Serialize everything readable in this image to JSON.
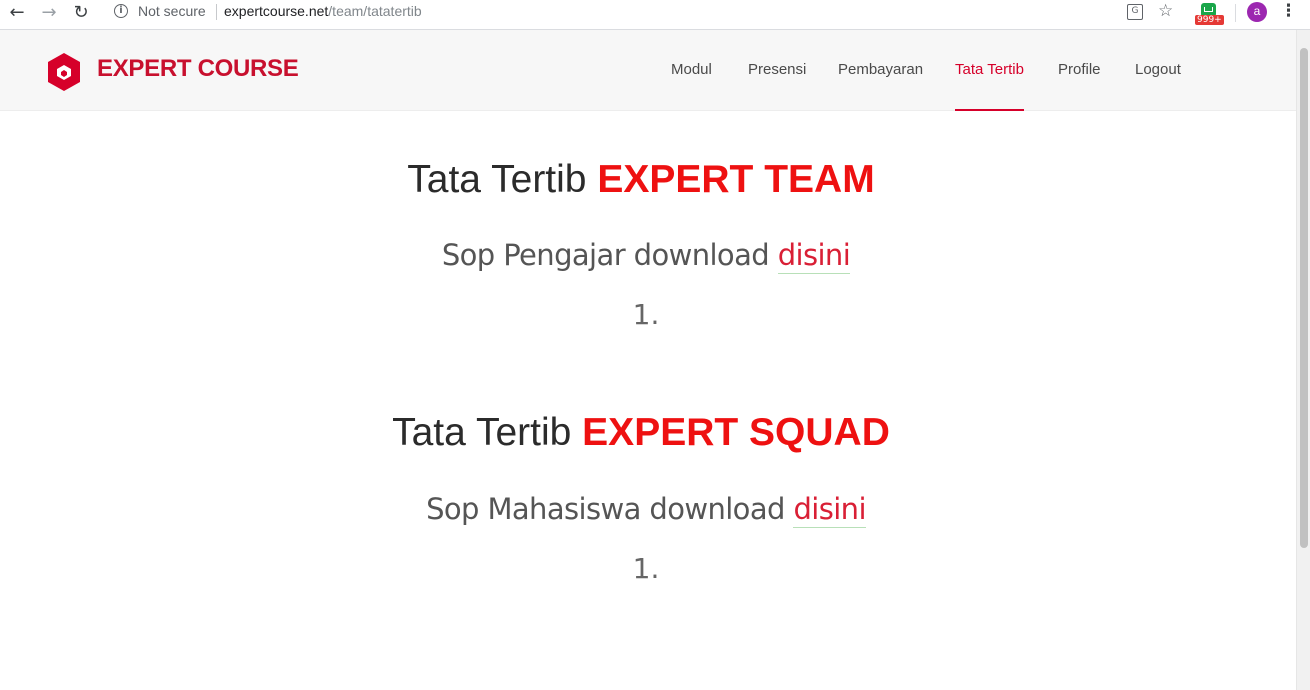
{
  "browser": {
    "security_label": "Not secure",
    "url_host": "expertcourse.net",
    "url_path": "/team/tatatertib",
    "extension_badge": "999+",
    "avatar_letter": "a"
  },
  "header": {
    "brand": "EXPERT COURSE",
    "brand_color": "#c8102e",
    "nav": [
      {
        "label": "Modul"
      },
      {
        "label": "Presensi"
      },
      {
        "label": "Pembayaran"
      },
      {
        "label": "Tata Tertib",
        "active": true
      },
      {
        "label": "Profile"
      },
      {
        "label": "Logout"
      }
    ]
  },
  "sections": [
    {
      "title_prefix": "Tata Tertib",
      "title_accent": "EXPERT TEAM",
      "sop_text": "Sop Pengajar download",
      "link_text": "disini",
      "item_number": "1."
    },
    {
      "title_prefix": "Tata Tertib",
      "title_accent": "EXPERT SQUAD",
      "sop_text": "Sop Mahasiswa download",
      "link_text": "disini",
      "item_number": "1."
    }
  ],
  "colors": {
    "accent": "#ee1111",
    "link": "#d91f35"
  }
}
